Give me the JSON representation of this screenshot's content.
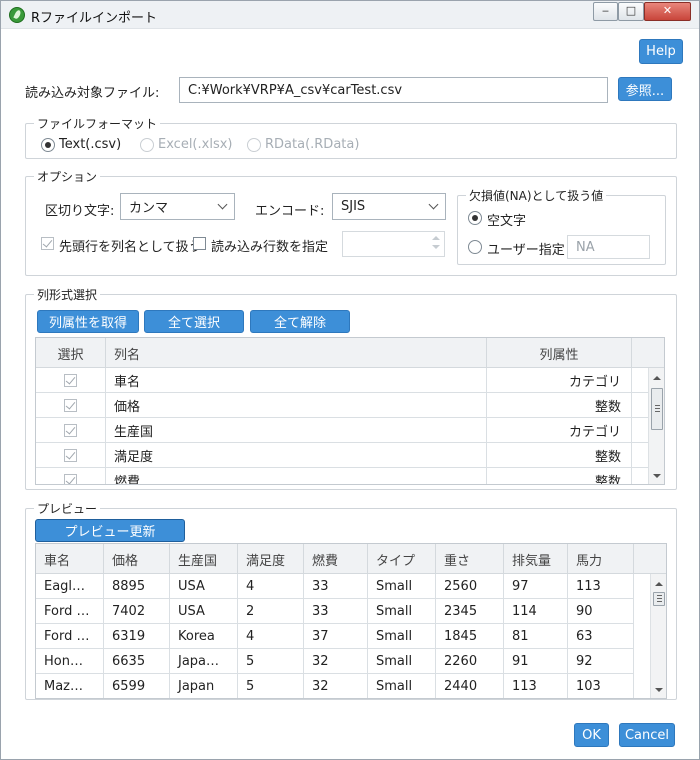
{
  "window": {
    "title": "Rファイルインポート",
    "minimize_glyph": "‒",
    "maximize_glyph": "□",
    "close_glyph": "✕"
  },
  "help_label": "Help",
  "file": {
    "label": "読み込み対象ファイル:",
    "path": "C:¥Work¥VRP¥A_csv¥carTest.csv",
    "browse_label": "参照..."
  },
  "format": {
    "title": "ファイルフォーマット",
    "options": [
      {
        "label": "Text(.csv)",
        "selected": true,
        "enabled": true
      },
      {
        "label": "Excel(.xlsx)",
        "selected": false,
        "enabled": false
      },
      {
        "label": "RData(.RData)",
        "selected": false,
        "enabled": false
      }
    ]
  },
  "options": {
    "title": "オプション",
    "delimiter_label": "区切り文字:",
    "delimiter_value": "カンマ",
    "encoding_label": "エンコード:",
    "encoding_value": "SJIS",
    "header_checkbox_label": "先頭行を列名として扱う",
    "header_checked": true,
    "rowcount_checkbox_label": "読み込み行数を指定",
    "rowcount_checked": false,
    "na": {
      "title": "欠損値(NA)として扱う値",
      "empty_label": "空文字",
      "user_label": "ユーザー指定",
      "user_value": "NA",
      "selected": "empty"
    }
  },
  "columns": {
    "title": "列形式選択",
    "get_attr_label": "列属性を取得",
    "select_all_label": "全て選択",
    "deselect_all_label": "全て解除",
    "headers": [
      "選択",
      "列名",
      "列属性"
    ],
    "rows": [
      {
        "selected": true,
        "name": "車名",
        "type": "カテゴリ"
      },
      {
        "selected": true,
        "name": "価格",
        "type": "整数"
      },
      {
        "selected": true,
        "name": "生産国",
        "type": "カテゴリ"
      },
      {
        "selected": true,
        "name": "満足度",
        "type": "整数"
      },
      {
        "selected": true,
        "name": "燃費",
        "type": "整数"
      }
    ]
  },
  "preview": {
    "title": "プレビュー",
    "refresh_label": "プレビュー更新",
    "headers": [
      "車名",
      "価格",
      "生産国",
      "満足度",
      "燃費",
      "タイプ",
      "重さ",
      "排気量",
      "馬力"
    ],
    "rows": [
      [
        "Eagl…",
        "8895",
        "USA",
        "4",
        "33",
        "Small",
        "2560",
        "97",
        "113"
      ],
      [
        "Ford …",
        "7402",
        "USA",
        "2",
        "33",
        "Small",
        "2345",
        "114",
        "90"
      ],
      [
        "Ford …",
        "6319",
        "Korea",
        "4",
        "37",
        "Small",
        "1845",
        "81",
        "63"
      ],
      [
        "Hon…",
        "6635",
        "Japa…",
        "5",
        "32",
        "Small",
        "2260",
        "91",
        "92"
      ],
      [
        "Maz…",
        "6599",
        "Japan",
        "5",
        "32",
        "Small",
        "2440",
        "113",
        "103"
      ]
    ]
  },
  "ok_label": "OK",
  "cancel_label": "Cancel"
}
